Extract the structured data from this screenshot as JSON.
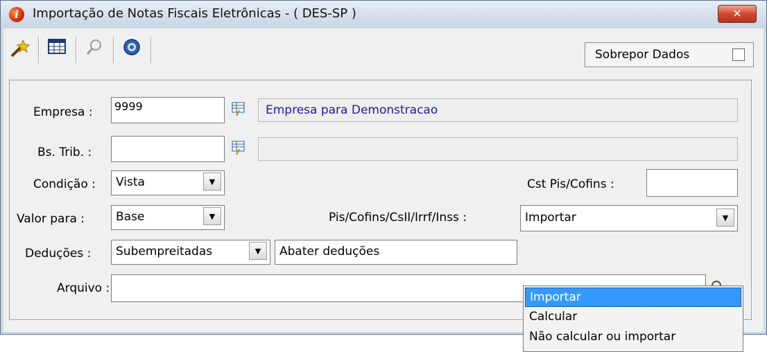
{
  "window": {
    "title": "Importação de Notas Fiscais Eletrônicas - ( DES-SP )",
    "close_label": "✕"
  },
  "toolbar": {
    "sobrepor_label": "Sobrepor Dados",
    "sobrepor_checked": false
  },
  "form": {
    "empresa": {
      "label": "Empresa :",
      "code": "9999",
      "description": "Empresa para Demonstracao"
    },
    "bs_trib": {
      "label": "Bs. Trib. :",
      "code": "",
      "description": ""
    },
    "condicao": {
      "label": "Condição :",
      "value": "Vista"
    },
    "cst": {
      "label": "Cst Pis/Cofins :",
      "value": ""
    },
    "valor_para": {
      "label": "Valor para :",
      "value": "Base"
    },
    "pis": {
      "label": "Pis/Cofins/CsII/Irrf/Inss :",
      "value": "Importar",
      "options": [
        "Importar",
        "Calcular",
        "Não calcular ou importar"
      ]
    },
    "deducoes": {
      "label": "Deduções :",
      "value": "Subempreitadas",
      "value2": "Abater deduções"
    },
    "arquivo": {
      "label": "Arquivo :",
      "value": ""
    }
  },
  "colors": {
    "selection": "#3399ff",
    "description_text": "#1a1aa0"
  },
  "icons": [
    "app-info-icon",
    "wand-icon",
    "grid-icon",
    "magnifier-icon",
    "help-icon",
    "lookup-icon",
    "chevron-down-icon"
  ]
}
